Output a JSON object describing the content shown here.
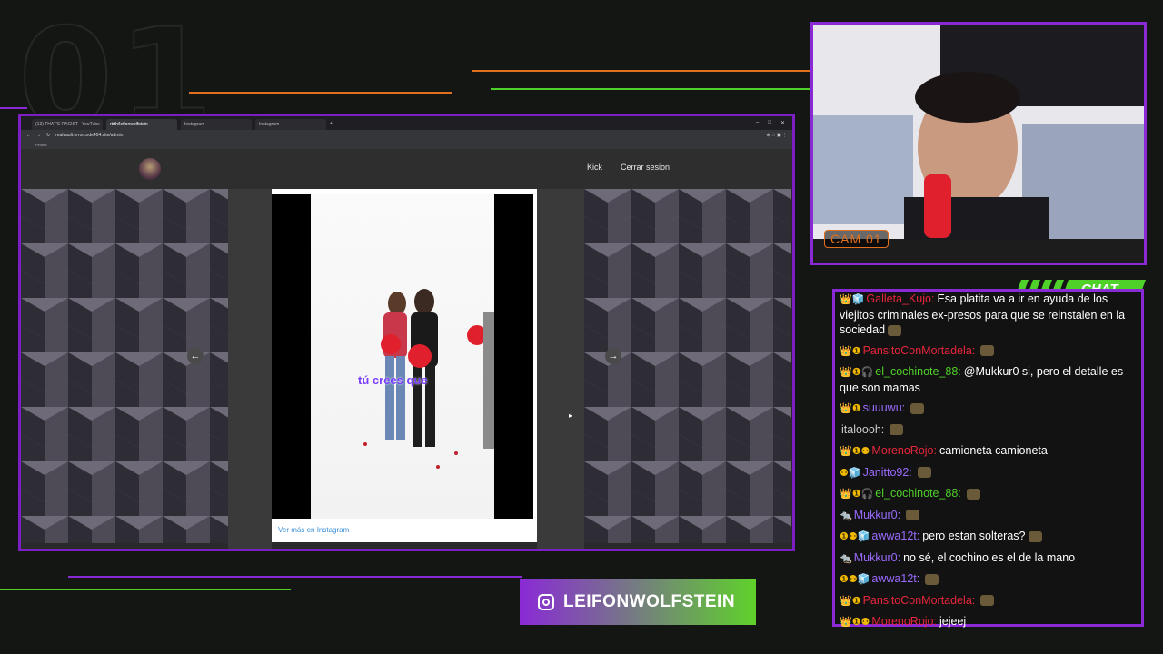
{
  "overlay": {
    "big_number": "01",
    "cam_label": "CAM 01",
    "chat_label": "CHAT",
    "social_handle": "LEIFONWOLFSTEIN",
    "colors": {
      "purple": "#8a2ad6",
      "green": "#4fd12a",
      "orange": "#e07020"
    }
  },
  "browser": {
    "tabs": [
      {
        "label": "(13) THAT'S RACIST - YouTube",
        "active": false
      },
      {
        "label": "rtrth/leifonwolfstein",
        "active": true
      },
      {
        "label": "Instagram",
        "active": false
      },
      {
        "label": "Instagram",
        "active": false
      }
    ],
    "url": "realvault.errorcode404.site/admin",
    "bookmark": "Pinned"
  },
  "site": {
    "nav": [
      "Kick",
      "Cerrar sesion"
    ],
    "video_caption": "tú crees que",
    "ver_mas": "Ver más en Instagram",
    "prev_icon": "arrow-left-icon",
    "next_icon": "arrow-right-icon"
  },
  "chat": {
    "messages": [
      {
        "user": "Galleta_Kujo",
        "color": "#e8263c",
        "badges": "👑🧊",
        "text": "Esa platita va a ir en ayuda de los viejitos criminales ex-presos para que se reinstalen en la sociedad",
        "emote": true
      },
      {
        "user": "PansitoConMortadela",
        "color": "#e8263c",
        "badges": "👑❶",
        "text": "",
        "emote": true
      },
      {
        "user": "el_cochinote_88",
        "color": "#4fd12a",
        "badges": "👑❶🎧",
        "text": "@Mukkur0 si, pero el detalle es que son mamas",
        "emote": false
      },
      {
        "user": "suuuwu",
        "color": "#9b6bff",
        "badges": "👑❶",
        "text": "",
        "emote": true
      },
      {
        "user": "italoooh",
        "color": "#cccccc",
        "badges": "",
        "text": "",
        "emote": true
      },
      {
        "user": "MorenoRojo",
        "color": "#e8263c",
        "badges": "👑❶⚉",
        "text": "camioneta camioneta",
        "emote": false
      },
      {
        "user": "Janitto92",
        "color": "#9b6bff",
        "badges": "⚉🧊",
        "text": "",
        "emote": true
      },
      {
        "user": "el_cochinote_88",
        "color": "#4fd12a",
        "badges": "👑❶🎧",
        "text": "",
        "emote": true
      },
      {
        "user": "Mukkur0",
        "color": "#9b6bff",
        "badges": "🐀",
        "text": "",
        "emote": true
      },
      {
        "user": "awwa12t",
        "color": "#9b6bff",
        "badges": "❶⚉🧊",
        "text": "pero estan solteras?",
        "emote": true
      },
      {
        "user": "Mukkur0",
        "color": "#9b6bff",
        "badges": "🐀",
        "text": "no sé, el cochino es el de la mano",
        "emote": false
      },
      {
        "user": "awwa12t",
        "color": "#9b6bff",
        "badges": "❶⚉🧊",
        "text": "",
        "emote": true
      },
      {
        "user": "PansitoConMortadela",
        "color": "#e8263c",
        "badges": "👑❶",
        "text": "",
        "emote": true
      },
      {
        "user": "MorenoRojo",
        "color": "#e8263c",
        "badges": "👑❶⚉",
        "text": "jejeej",
        "emote": false
      }
    ]
  }
}
